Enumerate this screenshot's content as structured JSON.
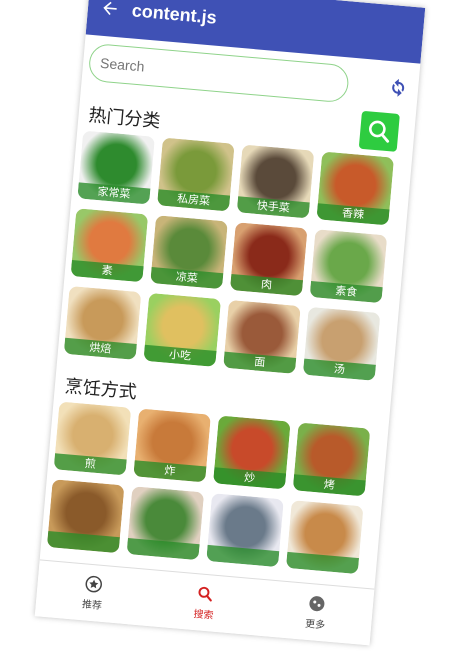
{
  "appbar": {
    "title": "content.js"
  },
  "search": {
    "placeholder": "Search"
  },
  "sections": {
    "categories": "热门分类",
    "methods": "烹饪方式"
  },
  "categories": [
    {
      "label": "家常菜",
      "colors": [
        "#2e8b2e",
        "#f0f0f0"
      ]
    },
    {
      "label": "私房菜",
      "colors": [
        "#7a9a3a",
        "#d0c28a"
      ]
    },
    {
      "label": "快手菜",
      "colors": [
        "#5a4a3a",
        "#e6d9b8"
      ]
    },
    {
      "label": "香辣",
      "colors": [
        "#c85a2a",
        "#8fbf5a"
      ]
    },
    {
      "label": "素",
      "colors": [
        "#e07a40",
        "#98c868"
      ]
    },
    {
      "label": "凉菜",
      "colors": [
        "#5a8a3a",
        "#c8b478"
      ]
    },
    {
      "label": "肉",
      "colors": [
        "#8a2a1a",
        "#d8a070"
      ]
    },
    {
      "label": "素食",
      "colors": [
        "#6aa84a",
        "#e8dcc8"
      ]
    },
    {
      "label": "烘焙",
      "colors": [
        "#c89a5a",
        "#f0e0c0"
      ]
    },
    {
      "label": "小吃",
      "colors": [
        "#e0c060",
        "#9ad060"
      ]
    },
    {
      "label": "面",
      "colors": [
        "#9a5a3a",
        "#e8d0a8"
      ]
    },
    {
      "label": "汤",
      "colors": [
        "#c8a070",
        "#e8e8e0"
      ]
    }
  ],
  "methods": [
    {
      "label": "煎",
      "colors": [
        "#d8b070",
        "#f2e0b8"
      ]
    },
    {
      "label": "炸",
      "colors": [
        "#c87a3a",
        "#e8b070"
      ]
    },
    {
      "label": "炒",
      "colors": [
        "#c84a2a",
        "#6aaa3a"
      ]
    },
    {
      "label": "烤",
      "colors": [
        "#b85a2a",
        "#7ab04a"
      ]
    },
    {
      "label": "",
      "colors": [
        "#8a5a2a",
        "#c89a5a"
      ]
    },
    {
      "label": "",
      "colors": [
        "#4a8a3a",
        "#e0d0c0"
      ]
    },
    {
      "label": "",
      "colors": [
        "#6a7a8a",
        "#e8e8f0"
      ]
    },
    {
      "label": "",
      "colors": [
        "#c88a4a",
        "#f0e8d8"
      ]
    }
  ],
  "nav": [
    {
      "label": "推荐",
      "icon": "star-circle-icon",
      "active": false
    },
    {
      "label": "搜索",
      "icon": "search-icon",
      "active": true
    },
    {
      "label": "更多",
      "icon": "more-icon",
      "active": false
    }
  ],
  "colors": {
    "primary": "#3f51b5",
    "accent": "#2ecc40",
    "active": "#d42222"
  }
}
